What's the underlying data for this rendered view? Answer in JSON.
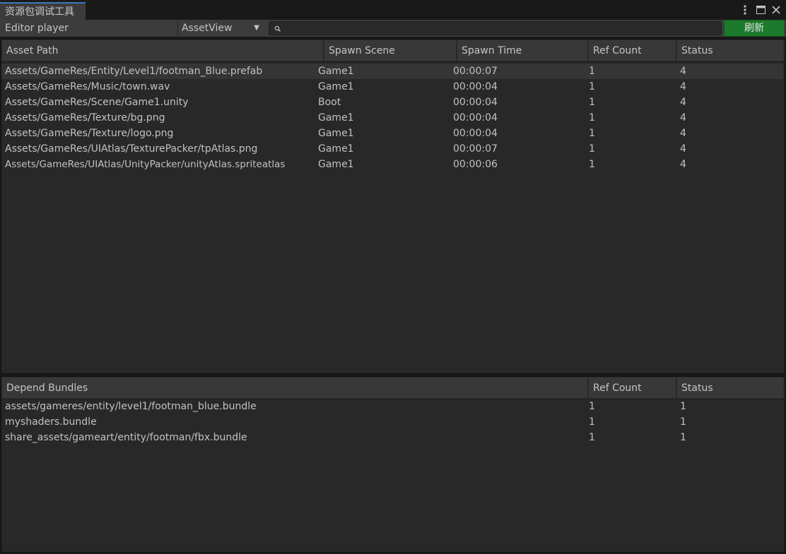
{
  "window": {
    "tab_title": "资源包调试工具",
    "menu_icon": "kebab-menu-icon",
    "maximize_icon": "maximize-icon",
    "close_icon": "close-icon"
  },
  "toolbar": {
    "player_label": "Editor player",
    "view_selected": "AssetView",
    "search_value": "",
    "search_icon": "search-icon",
    "refresh_label": "刷新",
    "refresh_color": "#1c7a2c"
  },
  "assets_table": {
    "columns": [
      "Asset Path",
      "Spawn Scene",
      "Spawn Time",
      "Ref Count",
      "Status"
    ],
    "rows": [
      [
        "Assets/GameRes/Entity/Level1/footman_Blue.prefab",
        "Game1",
        "00:00:07",
        "1",
        "4"
      ],
      [
        "Assets/GameRes/Music/town.wav",
        "Game1",
        "00:00:04",
        "1",
        "4"
      ],
      [
        "Assets/GameRes/Scene/Game1.unity",
        "Boot",
        "00:00:04",
        "1",
        "4"
      ],
      [
        "Assets/GameRes/Texture/bg.png",
        "Game1",
        "00:00:04",
        "1",
        "4"
      ],
      [
        "Assets/GameRes/Texture/logo.png",
        "Game1",
        "00:00:04",
        "1",
        "4"
      ],
      [
        "Assets/GameRes/UIAtlas/TexturePacker/tpAtlas.png",
        "Game1",
        "00:00:07",
        "1",
        "4"
      ],
      [
        "Assets/GameRes/UIAtlas/UnityPacker/unityAtlas.spriteatlas",
        "Game1",
        "00:00:06",
        "1",
        "4"
      ]
    ]
  },
  "bundles_table": {
    "columns": [
      "Depend Bundles",
      "Ref Count",
      "Status"
    ],
    "rows": [
      [
        "assets/gameres/entity/level1/footman_blue.bundle",
        "1",
        "1"
      ],
      [
        "myshaders.bundle",
        "1",
        "1"
      ],
      [
        "share_assets/gameart/entity/footman/fbx.bundle",
        "1",
        "1"
      ]
    ]
  }
}
